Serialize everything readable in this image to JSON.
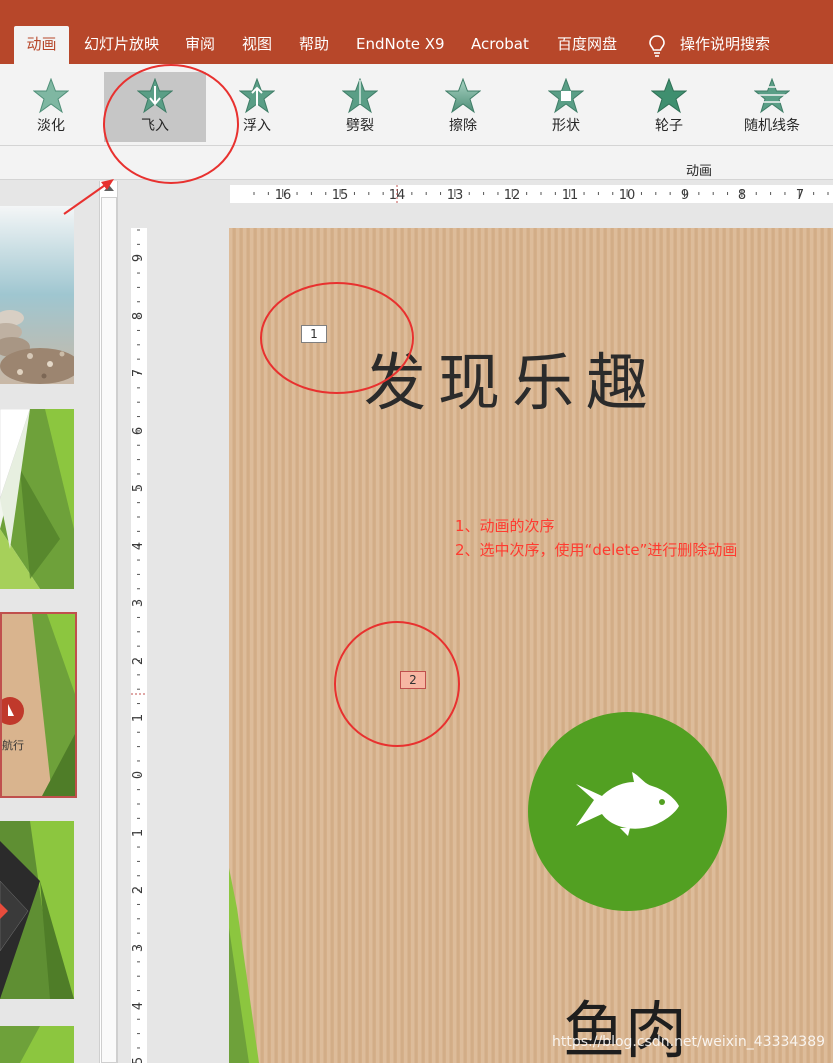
{
  "ribbon": {
    "tabs": [
      {
        "label": "动画",
        "active": true
      },
      {
        "label": "幻灯片放映"
      },
      {
        "label": "审阅"
      },
      {
        "label": "视图"
      },
      {
        "label": "帮助"
      },
      {
        "label": "EndNote X9"
      },
      {
        "label": "Acrobat"
      },
      {
        "label": "百度网盘"
      },
      {
        "label": "操作说明搜索"
      }
    ],
    "effects": [
      {
        "label": "淡化",
        "icon": "star-icon"
      },
      {
        "label": "飞入",
        "icon": "star-fly-in-icon",
        "selected": true
      },
      {
        "label": "浮入",
        "icon": "star-float-in-icon"
      },
      {
        "label": "劈裂",
        "icon": "star-split-icon"
      },
      {
        "label": "擦除",
        "icon": "star-wipe-icon"
      },
      {
        "label": "形状",
        "icon": "star-shape-icon"
      },
      {
        "label": "轮子",
        "icon": "star-wheel-icon"
      },
      {
        "label": "随机线条",
        "icon": "star-random-bars-icon"
      }
    ],
    "group_label": "动画",
    "colors": {
      "tab_bar": "#b7472a",
      "ribbon": "#f3f3f3",
      "star": "#5a9e86"
    }
  },
  "thumbnails": {
    "visible_text": "航行"
  },
  "rulers": {
    "horizontal_ticks": [
      "16",
      "15",
      "14",
      "13",
      "12",
      "11",
      "10",
      "9",
      "8",
      "7"
    ],
    "vertical_ticks": [
      "9",
      "8",
      "7",
      "6",
      "5",
      "4",
      "3",
      "2",
      "1",
      "0",
      "1",
      "2",
      "3",
      "4",
      "5"
    ]
  },
  "slide": {
    "title": "发现乐趣",
    "animation_tags": [
      "1",
      "2"
    ],
    "notes": [
      "1、动画的次序",
      "2、选中次序，使用“delete”进行删除动画"
    ],
    "subtitle": "鱼肉",
    "fish_icon": "fish-icon",
    "colors": {
      "circle": "#52a022",
      "note": "#ff3b30",
      "annotation": "#e8312f"
    }
  },
  "watermark": "https://blog.csdn.net/weixin_43334389"
}
